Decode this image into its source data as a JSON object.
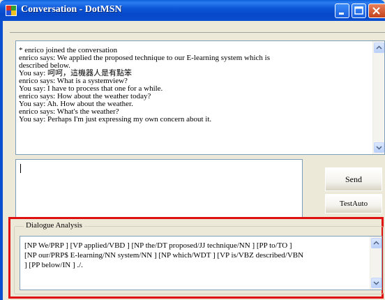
{
  "window": {
    "title": "Conversation - DotMSN"
  },
  "conversation": {
    "lines": [
      "* enrico joined the conversation",
      "enrico says: We applied the proposed technique to our E-learning system which is",
      "described below.",
      "You say: 呵呵，這機器人是有點笨",
      "enrico says: What is a systemview?",
      "You say: I have to process that one for a while.",
      "enrico says: How about the weather today?",
      "You say: Ah. How about the weather.",
      "enrico says: What's the weather?",
      "You say: Perhaps I'm just expressing my own concern about it."
    ]
  },
  "input": {
    "value": ""
  },
  "buttons": {
    "send_label": "Send",
    "testauto_label": "TestAuto"
  },
  "analysis": {
    "label": "Dialogue Analysis",
    "lines": [
      "[NP We/PRP ] [VP applied/VBD ] [NP the/DT proposed/JJ technique/NN ] [PP to/TO ]",
      "[NP our/PRP$ E-learning/NN system/NN ] [NP which/WDT ] [VP is/VBZ described/VBN",
      "] [PP below/IN ] ./."
    ]
  },
  "colors": {
    "title_bar": "#0a4fd0",
    "window_bg": "#ece9d8",
    "highlight_border": "#e01010",
    "close_button": "#c4421c"
  },
  "icons": [
    "app-icon",
    "minimize-icon",
    "maximize-icon",
    "close-icon",
    "scroll-up-icon",
    "scroll-down-icon"
  ]
}
